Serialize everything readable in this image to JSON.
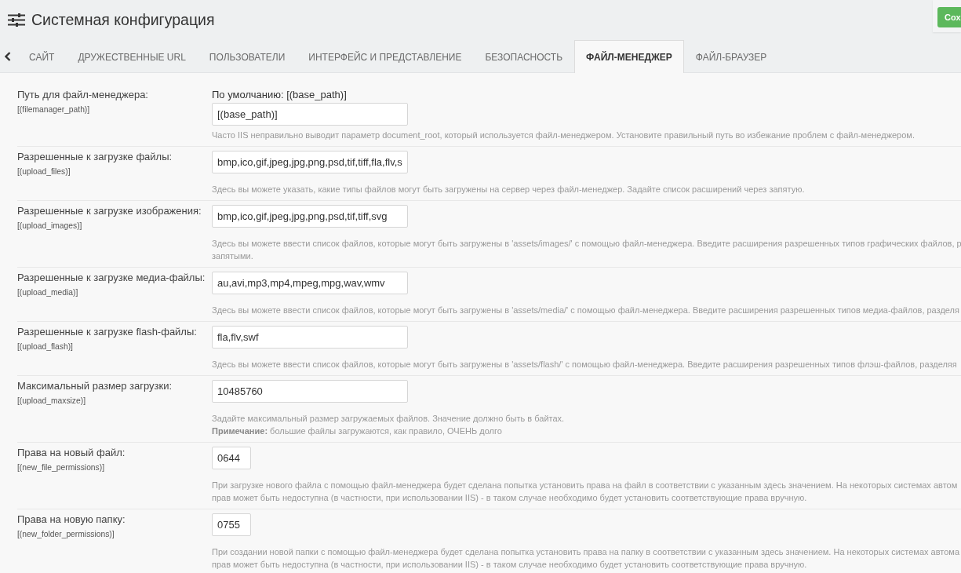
{
  "header": {
    "title": "Системная конфигурация",
    "save_button": "Сох"
  },
  "tabs": [
    {
      "label": "САЙТ",
      "selected": false
    },
    {
      "label": "ДРУЖЕСТВЕННЫЕ URL",
      "selected": false
    },
    {
      "label": "ПОЛЬЗОВАТЕЛИ",
      "selected": false
    },
    {
      "label": "ИНТЕРФЕЙС И ПРЕДСТАВЛЕНИЕ",
      "selected": false
    },
    {
      "label": "БЕЗОПАСНОСТЬ",
      "selected": false
    },
    {
      "label": "ФАЙЛ-МЕНЕДЖЕР",
      "selected": true
    },
    {
      "label": "ФАЙЛ-БРАУЗЕР",
      "selected": false
    }
  ],
  "settings": [
    {
      "label": "Путь для файл-менеджера:",
      "key": "[(filemanager_path)]",
      "default_note": "По умолчанию: [(base_path)]",
      "value": "[(base_path)]",
      "kind": "wide",
      "help_lines": [
        "Часто IIS неправильно выводит параметр document_root, который используется файл-менеджером. Установите правильный путь во избежание проблем с файл-менеджером."
      ]
    },
    {
      "label": "Разрешенные к загрузке файлы:",
      "key": "[(upload_files)]",
      "value": "bmp,ico,gif,jpeg,jpg,png,psd,tif,tiff,fla,flv,s",
      "kind": "wide",
      "help_lines": [
        "Здесь вы можете указать, какие типы файлов могут быть загружены на сервер через файл-менеджер. Задайте список расширений через запятую."
      ]
    },
    {
      "label": "Разрешенные к загрузке изображения:",
      "key": "[(upload_images)]",
      "value": "bmp,ico,gif,jpeg,jpg,png,psd,tif,tiff,svg",
      "kind": "wide",
      "help_lines": [
        "Здесь вы можете ввести список файлов, которые могут быть загружены в 'assets/images/' с помощью файл-менеджера. Введите расширения разрешенных типов графических файлов, р",
        "запятыми."
      ]
    },
    {
      "label": "Разрешенные к загрузке медиа-файлы:",
      "key": "[(upload_media)]",
      "value": "au,avi,mp3,mp4,mpeg,mpg,wav,wmv",
      "kind": "wide",
      "help_lines": [
        "Здесь вы можете ввести список файлов, которые могут быть загружены в 'assets/media/' с помощью файл-менеджера. Введите расширения разрешенных типов медиа-файлов, разделя"
      ]
    },
    {
      "label": "Разрешенные к загрузке flash-файлы:",
      "key": "[(upload_flash)]",
      "value": "fla,flv,swf",
      "kind": "wide",
      "help_lines": [
        "Здесь вы можете ввести список файлов, которые могут быть загружены в 'assets/flash/' с помощью файл-менеджера. Введите расширения разрешенных типов флэш-файлов, разделяя"
      ]
    },
    {
      "label": "Максимальный размер загрузки:",
      "key": "[(upload_maxsize)]",
      "value": "10485760",
      "kind": "wide",
      "help_lines": [
        "Задайте максимальный размер загружаемых файлов. Значение должно быть в байтах.",
        "**Примечание:** большие файлы загружаются, как правило, ОЧЕНЬ долго"
      ]
    },
    {
      "label": "Права на новый файл:",
      "key": "[(new_file_permissions)]",
      "value": "0644",
      "kind": "narrow",
      "help_lines": [
        "При загрузке нового файла с помощью файл-менеджера будет сделана попытка установить права на файл в соответствии с указанным здесь значением. На некоторых системах автом",
        "прав может быть недоступна (в частности, при использовании IIS) - в таком случае необходимо будет установить соответствующие права вручную."
      ]
    },
    {
      "label": "Права на новую папку:",
      "key": "[(new_folder_permissions)]",
      "value": "0755",
      "kind": "narrow",
      "help_lines": [
        "При создании новой папки с помощью файл-менеджера будет сделана попытка установить права на папку в соответствии с указанным здесь значением. На некоторых системах автома",
        "прав может быть недоступна (в частности, при использовании IIS) - в таком случае необходимо будет установить соответствующие права вручную."
      ]
    }
  ]
}
